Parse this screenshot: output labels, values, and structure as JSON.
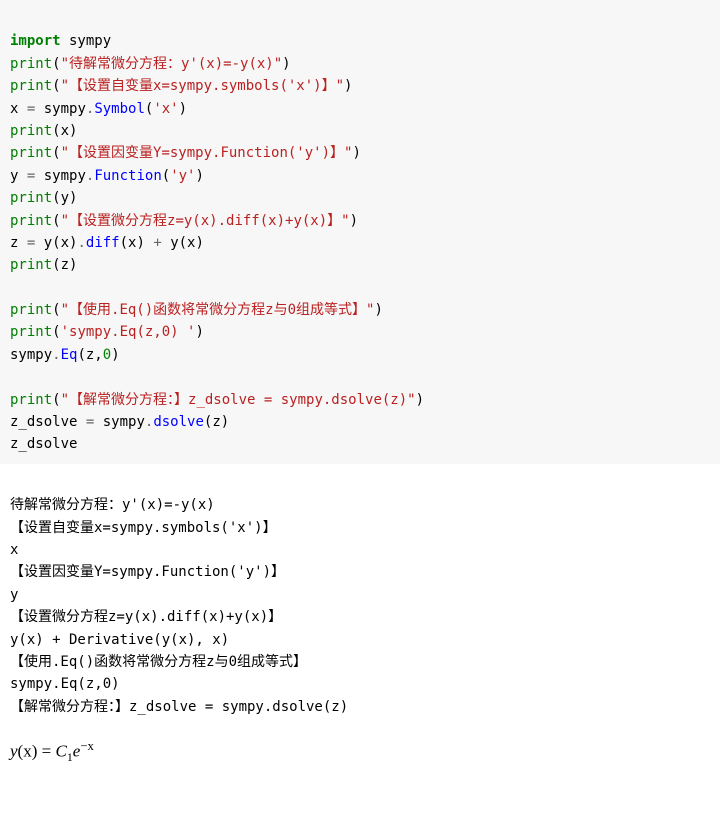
{
  "code": {
    "l1_kw": "import",
    "l1_mod": " sympy",
    "l2_fn": "print",
    "l2_p1": "(",
    "l2_str": "\"待解常微分方程：y'(x)=-y(x)\"",
    "l2_p2": ")",
    "l3_fn": "print",
    "l3_p1": "(",
    "l3_str": "\"【设置自变量x=sympy.symbols('x')】\"",
    "l3_p2": ")",
    "l4_lhs": "x ",
    "l4_eq": "=",
    "l4_obj": " sympy",
    "l4_dot": ".",
    "l4_call": "Symbol",
    "l4_arg": "(",
    "l4_str": "'x'",
    "l4_arg2": ")",
    "l5_fn": "print",
    "l5_arg": "(x)",
    "l6_fn": "print",
    "l6_p1": "(",
    "l6_str": "\"【设置因变量Y=sympy.Function('y')】\"",
    "l6_p2": ")",
    "l7_lhs": "y ",
    "l7_eq": "=",
    "l7_obj": " sympy",
    "l7_dot": ".",
    "l7_call": "Function",
    "l7_arg": "(",
    "l7_str": "'y'",
    "l7_arg2": ")",
    "l8_fn": "print",
    "l8_arg": "(y)",
    "l9_fn": "print",
    "l9_p1": "(",
    "l9_str": "\"【设置微分方程z=y(x).diff(x)+y(x)】\"",
    "l9_p2": ")",
    "l10_lhs": "z ",
    "l10_eq": "=",
    "l10_a": " y(x)",
    "l10_dot": ".",
    "l10_call": "diff",
    "l10_arg": "(x) ",
    "l10_plus": "+",
    "l10_b": " y(x)",
    "l11_fn": "print",
    "l11_arg": "(z)",
    "blank": "",
    "l13_fn": "print",
    "l13_p1": "(",
    "l13_str": "\"【使用.Eq()函数将常微分方程z与0组成等式】\"",
    "l13_p2": ")",
    "l14_fn": "print",
    "l14_p1": "(",
    "l14_str": "'sympy.Eq(z,0) '",
    "l14_p2": ")",
    "l15_obj": "sympy",
    "l15_dot": ".",
    "l15_call": "Eq",
    "l15_arg": "(z,",
    "l15_num": "0",
    "l15_arg2": ")",
    "l17_fn": "print",
    "l17_p1": "(",
    "l17_str": "\"【解常微分方程：】z_dsolve = sympy.dsolve(z)\"",
    "l17_p2": ")",
    "l18_lhs": "z_dsolve ",
    "l18_eq": "=",
    "l18_obj": " sympy",
    "l18_dot": ".",
    "l18_call": "dsolve",
    "l18_arg": "(z)",
    "l19": "z_dsolve"
  },
  "output": {
    "o1": "待解常微分方程：y'(x)=-y(x)",
    "o2": "【设置自变量x=sympy.symbols('x')】",
    "o3": "x",
    "o4": "【设置因变量Y=sympy.Function('y')】",
    "o5": "y",
    "o6": "【设置微分方程z=y(x).diff(x)+y(x)】",
    "o7": "y(x) + Derivative(y(x), x)",
    "o8": "【使用.Eq()函数将常微分方程z与0组成等式】",
    "o9": "sympy.Eq(z,0) ",
    "o10": "【解常微分方程：】z_dsolve = sympy.dsolve(z)"
  },
  "math": {
    "yx": "y",
    "paren_x": "(x)",
    "eq": " = ",
    "C": "C",
    "sub1": "1",
    "e": "e",
    "exp": "−x"
  }
}
